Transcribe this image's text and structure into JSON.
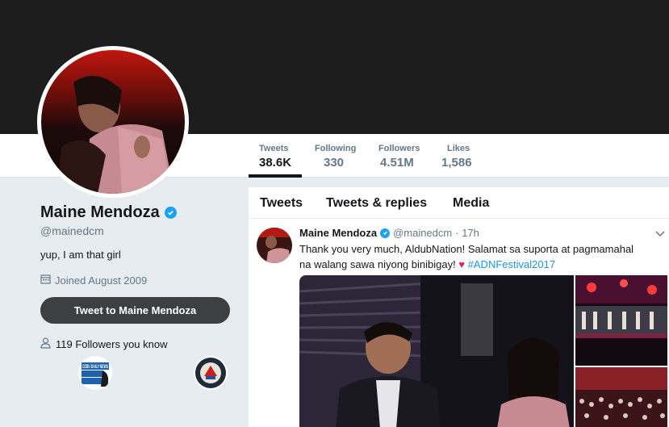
{
  "profile": {
    "name": "Maine Mendoza",
    "handle": "@mainedcm",
    "bio": "yup, I am that girl",
    "joined": "Joined August 2009",
    "tweet_to_label": "Tweet to Maine Mendoza",
    "followers_you_know": "119 Followers you know",
    "fyk_logo_text": "CEBU DAILY NEWS"
  },
  "stats": [
    {
      "label": "Tweets",
      "value": "38.6K"
    },
    {
      "label": "Following",
      "value": "330"
    },
    {
      "label": "Followers",
      "value": "4.51M"
    },
    {
      "label": "Likes",
      "value": "1,586"
    }
  ],
  "tabs": [
    "Tweets",
    "Tweets & replies",
    "Media"
  ],
  "tweet": {
    "name": "Maine Mendoza",
    "handle": "@mainedcm",
    "time": "· 17h",
    "text_1": "Thank you very much, AldubNation! Salamat sa suporta at pagmamahal na walang sawa niyong binibigay!",
    "heart": "♥",
    "hashtag": "#ADNFestival2017"
  },
  "colors": {
    "accent": "#1da1f2",
    "banner": "#1d1d1d",
    "button": "#3d3f42",
    "hashtag": "#1b95e0",
    "heart": "#e0245e"
  }
}
